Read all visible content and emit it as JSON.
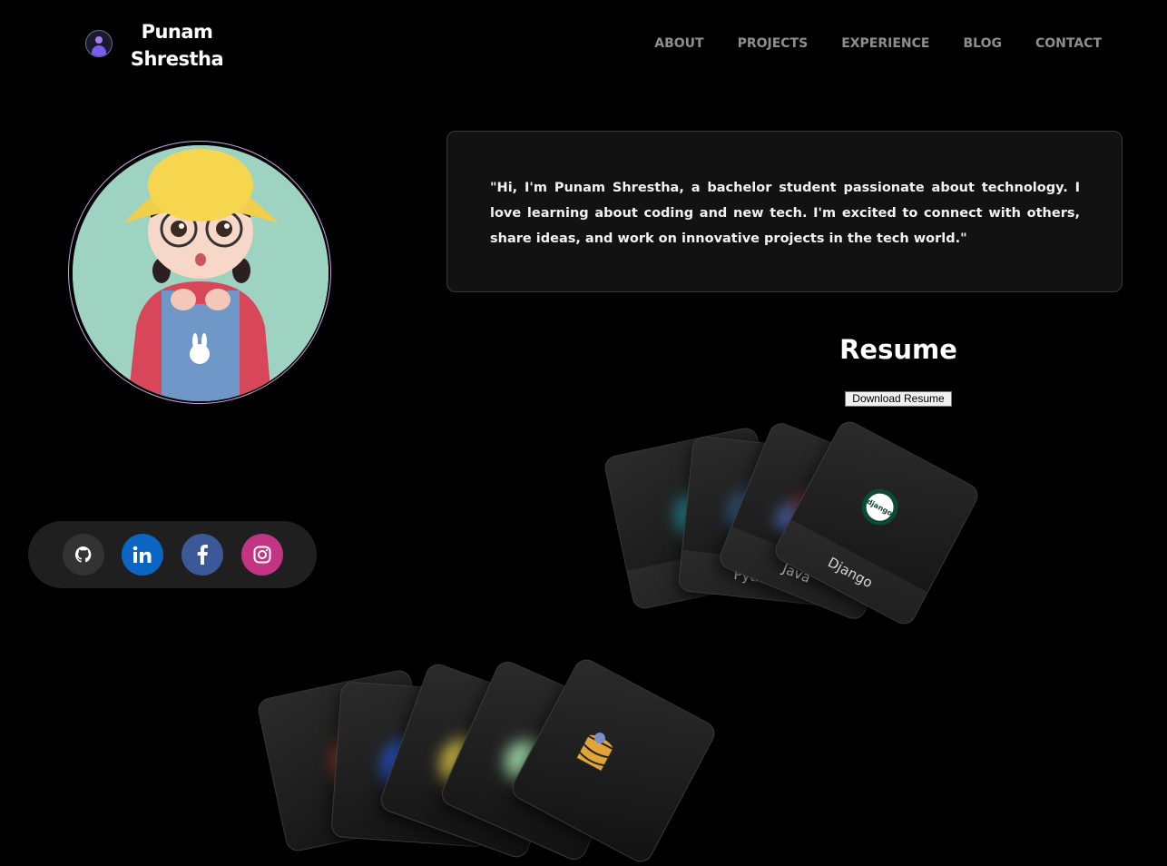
{
  "header": {
    "brand_line1": "Punam",
    "brand_line2": "Shrestha",
    "nav": [
      "ABOUT",
      "PROJECTS",
      "EXPERIENCE",
      "BLOG",
      "CONTACT"
    ]
  },
  "intro": {
    "text": "\"Hi, I'm Punam Shrestha, a bachelor student passionate about technology. I love learning about coding and new tech. I'm excited to connect with others, share ideas, and work on innovative projects in the tech world.\""
  },
  "resume": {
    "title": "Resume",
    "button": "Download Resume"
  },
  "social": [
    {
      "icon": "github-icon",
      "color": "#333333"
    },
    {
      "icon": "linkedin-icon",
      "color": "#0a66c2"
    },
    {
      "icon": "facebook-icon",
      "color": "#3b5998"
    },
    {
      "icon": "instagram-icon",
      "color": "#c13584"
    }
  ],
  "skill_cards_row1": [
    {
      "label": "",
      "icon": "react-icon"
    },
    {
      "label": "Python",
      "icon": "python-icon"
    },
    {
      "label": "Java",
      "icon": "java-icon"
    },
    {
      "label": "Django",
      "icon": "django-icon",
      "logo_text": "django"
    }
  ],
  "skill_cards_row2": [
    {
      "label": "",
      "icon": "html-icon"
    },
    {
      "label": "",
      "icon": "css-icon"
    },
    {
      "label": "",
      "icon": "javascript-icon"
    },
    {
      "label": "",
      "icon": "node-icon"
    },
    {
      "label": "",
      "icon": "database-icon"
    }
  ],
  "colors": {
    "accent": "#a77df5",
    "background": "#000000",
    "card": "#121212"
  }
}
